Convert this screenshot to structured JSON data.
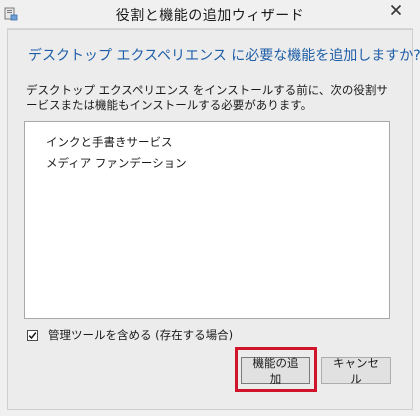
{
  "window": {
    "title": "役割と機能の追加ウィザード"
  },
  "dialog": {
    "heading": "デスクトップ エクスペリエンス に必要な機能を追加しますか?",
    "description": "デスクトップ エクスペリエンス をインストールする前に、次の役割サービスまたは機能もインストールする必要があります。",
    "features": [
      "インクと手書きサービス",
      "メディア ファンデーション"
    ],
    "include_tools": {
      "label": "管理ツールを含める (存在する場合)",
      "checked": true
    },
    "buttons": {
      "add_features": "機能の追加",
      "cancel": "キャンセル"
    }
  },
  "colors": {
    "heading": "#1e5ea8",
    "highlight": "#d0142c"
  },
  "icons": {
    "app": "server-manager-icon",
    "close": "close-icon",
    "check": "checkmark-icon"
  }
}
